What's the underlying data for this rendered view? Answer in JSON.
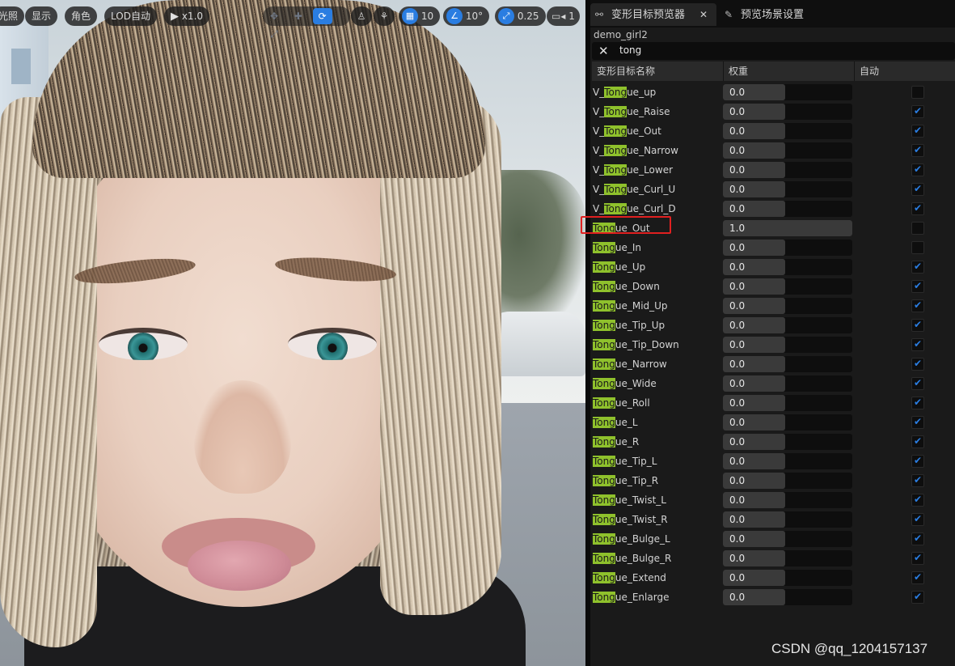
{
  "viewport": {
    "toolbar": {
      "lighting_label": "光照",
      "show_label": "显示",
      "character_label": "角色",
      "lod_label": "LOD自动",
      "play_speed": "x1.0",
      "grid_value": "10",
      "angle_value": "10°",
      "scale_value": "0.25",
      "camera_value": "1"
    }
  },
  "panel": {
    "tabs": [
      {
        "label": "变形目标预览器",
        "icon": "morph-icon",
        "active": true
      },
      {
        "label": "预览场景设置",
        "icon": "wrench-icon",
        "active": false
      }
    ],
    "asset_name": "demo_girl2",
    "search": {
      "value": "tong"
    },
    "columns": {
      "name": "变形目标名称",
      "weight": "权重",
      "auto": "自动"
    },
    "highlight_term": "Tong",
    "rows": [
      {
        "prefix": "V_",
        "match": "Tong",
        "suffix": "ue_up",
        "weight": "0.0",
        "fill": 0.48,
        "auto": false
      },
      {
        "prefix": "V_",
        "match": "Tong",
        "suffix": "ue_Raise",
        "weight": "0.0",
        "fill": 0.48,
        "auto": true
      },
      {
        "prefix": "V_",
        "match": "Tong",
        "suffix": "ue_Out",
        "weight": "0.0",
        "fill": 0.48,
        "auto": true
      },
      {
        "prefix": "V_",
        "match": "Tong",
        "suffix": "ue_Narrow",
        "weight": "0.0",
        "fill": 0.48,
        "auto": true
      },
      {
        "prefix": "V_",
        "match": "Tong",
        "suffix": "ue_Lower",
        "weight": "0.0",
        "fill": 0.48,
        "auto": true
      },
      {
        "prefix": "V_",
        "match": "Tong",
        "suffix": "ue_Curl_U",
        "weight": "0.0",
        "fill": 0.48,
        "auto": true
      },
      {
        "prefix": "V_",
        "match": "Tong",
        "suffix": "ue_Curl_D",
        "weight": "0.0",
        "fill": 0.48,
        "auto": true
      },
      {
        "prefix": "",
        "match": "Tong",
        "suffix": "ue_Out",
        "weight": "1.0",
        "fill": 1.0,
        "auto": false
      },
      {
        "prefix": "",
        "match": "Tong",
        "suffix": "ue_In",
        "weight": "0.0",
        "fill": 0.48,
        "auto": false
      },
      {
        "prefix": "",
        "match": "Tong",
        "suffix": "ue_Up",
        "weight": "0.0",
        "fill": 0.48,
        "auto": true
      },
      {
        "prefix": "",
        "match": "Tong",
        "suffix": "ue_Down",
        "weight": "0.0",
        "fill": 0.48,
        "auto": true
      },
      {
        "prefix": "",
        "match": "Tong",
        "suffix": "ue_Mid_Up",
        "weight": "0.0",
        "fill": 0.48,
        "auto": true
      },
      {
        "prefix": "",
        "match": "Tong",
        "suffix": "ue_Tip_Up",
        "weight": "0.0",
        "fill": 0.48,
        "auto": true
      },
      {
        "prefix": "",
        "match": "Tong",
        "suffix": "ue_Tip_Down",
        "weight": "0.0",
        "fill": 0.48,
        "auto": true
      },
      {
        "prefix": "",
        "match": "Tong",
        "suffix": "ue_Narrow",
        "weight": "0.0",
        "fill": 0.48,
        "auto": true
      },
      {
        "prefix": "",
        "match": "Tong",
        "suffix": "ue_Wide",
        "weight": "0.0",
        "fill": 0.48,
        "auto": true
      },
      {
        "prefix": "",
        "match": "Tong",
        "suffix": "ue_Roll",
        "weight": "0.0",
        "fill": 0.48,
        "auto": true
      },
      {
        "prefix": "",
        "match": "Tong",
        "suffix": "ue_L",
        "weight": "0.0",
        "fill": 0.48,
        "auto": true
      },
      {
        "prefix": "",
        "match": "Tong",
        "suffix": "ue_R",
        "weight": "0.0",
        "fill": 0.48,
        "auto": true
      },
      {
        "prefix": "",
        "match": "Tong",
        "suffix": "ue_Tip_L",
        "weight": "0.0",
        "fill": 0.48,
        "auto": true
      },
      {
        "prefix": "",
        "match": "Tong",
        "suffix": "ue_Tip_R",
        "weight": "0.0",
        "fill": 0.48,
        "auto": true
      },
      {
        "prefix": "",
        "match": "Tong",
        "suffix": "ue_Twist_L",
        "weight": "0.0",
        "fill": 0.48,
        "auto": true
      },
      {
        "prefix": "",
        "match": "Tong",
        "suffix": "ue_Twist_R",
        "weight": "0.0",
        "fill": 0.48,
        "auto": true
      },
      {
        "prefix": "",
        "match": "Tong",
        "suffix": "ue_Bulge_L",
        "weight": "0.0",
        "fill": 0.48,
        "auto": true
      },
      {
        "prefix": "",
        "match": "Tong",
        "suffix": "ue_Bulge_R",
        "weight": "0.0",
        "fill": 0.48,
        "auto": true
      },
      {
        "prefix": "",
        "match": "Tong",
        "suffix": "ue_Extend",
        "weight": "0.0",
        "fill": 0.48,
        "auto": true
      },
      {
        "prefix": "",
        "match": "Tong",
        "suffix": "ue_Enlarge",
        "weight": "0.0",
        "fill": 0.48,
        "auto": true
      }
    ],
    "highlighted_row": 7
  },
  "watermark": "CSDN @qq_1204157137",
  "colors": {
    "accent": "#2a7de1",
    "search_highlight": "#8fc12c",
    "annotation_box": "#e02020"
  }
}
